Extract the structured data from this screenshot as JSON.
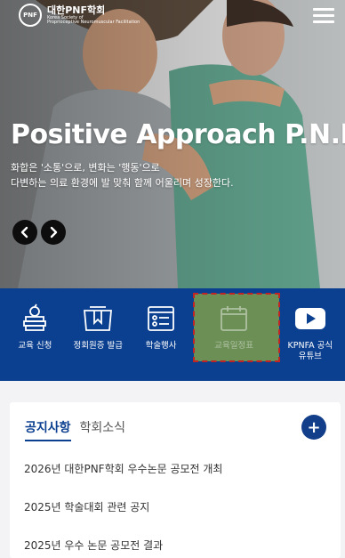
{
  "header": {
    "logo_badge": "PNF",
    "logo_title": "대한PNF학회",
    "logo_sub1": "Korea Society of",
    "logo_sub2": "Proprioceptive Neuromuscular Facilitation",
    "menu_icon": "hamburger-menu-icon"
  },
  "hero": {
    "title": "Positive Approach P.N.F.",
    "desc_line1": "화합은 '소통'으로, 변화는 '행동'으로",
    "desc_line2": "다변하는 의료 환경에 발 맞춰 함께 어울리며 성장한다.",
    "prev_icon": "chevron-left-icon",
    "next_icon": "chevron-right-icon"
  },
  "quick_menu": {
    "background": "#0b3f8f",
    "items": [
      {
        "label": "교육 신청",
        "icon": "books-apple-icon"
      },
      {
        "label": "정회원증 발급",
        "icon": "member-card-icon"
      },
      {
        "label": "학술행사",
        "icon": "event-list-icon"
      },
      {
        "label": "교육일정표",
        "icon": "calendar-icon"
      },
      {
        "label_line1": "KPNFA 공식",
        "label_line2": "유튜브",
        "icon": "youtube-icon"
      }
    ]
  },
  "notice": {
    "tabs": [
      {
        "label": "공지사항",
        "active": true
      },
      {
        "label": "학회소식",
        "active": false
      }
    ],
    "more_label": "+",
    "items": [
      "2026년 대한PNF학회 우수논문 공모전 개최",
      "2025년 학술대회 관련 공지",
      "2025년 우수 논문 공모전 결과"
    ]
  }
}
